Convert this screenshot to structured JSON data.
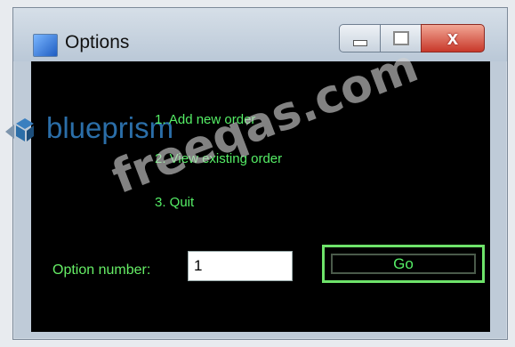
{
  "window": {
    "title": "Options",
    "icons": {
      "app": "app-window-icon",
      "minimize": "minimize-icon",
      "maximize": "maximize-icon",
      "close": "close-icon"
    },
    "close_glyph": "x"
  },
  "logo": {
    "text": "blueprism",
    "icon": "blueprism-logo-icon",
    "color": "#2b6ea8"
  },
  "menu": {
    "items": [
      {
        "label": "1. Add new order"
      },
      {
        "label": "2. View existing order"
      },
      {
        "label": "3. Quit"
      }
    ],
    "text_color": "#55ee66"
  },
  "option": {
    "label": "Option number:",
    "value": "1"
  },
  "go_button": {
    "label": "Go"
  },
  "watermark": "freeqas.com"
}
